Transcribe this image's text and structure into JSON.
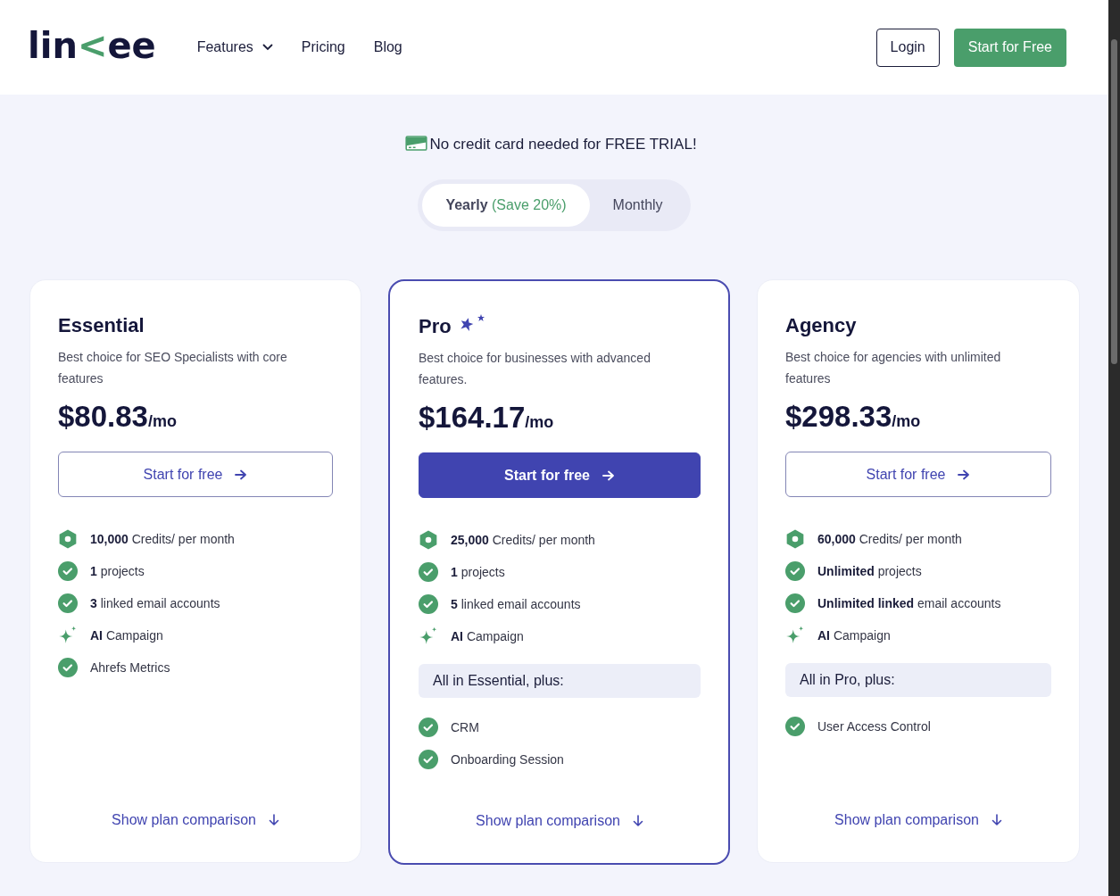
{
  "header": {
    "logo": {
      "lead": "lin",
      "mark": "<",
      "tail": "ee"
    },
    "nav": [
      {
        "label": "Features",
        "dropdown": true
      },
      {
        "label": "Pricing",
        "dropdown": false
      },
      {
        "label": "Blog",
        "dropdown": false
      }
    ],
    "login": "Login",
    "cta": "Start for Free"
  },
  "notice": "No credit card needed for FREE TRIAL!",
  "billing_toggle": [
    {
      "label": "Yearly",
      "note": "(Save 20%)",
      "selected": true
    },
    {
      "label": "Monthly",
      "selected": false
    }
  ],
  "plans": [
    {
      "name": "Essential",
      "featured": false,
      "description": "Best choice for SEO Specialists with core features",
      "price": "$80.83",
      "unit": "/mo",
      "button": "Start for free",
      "features": [
        {
          "kind": "credits",
          "text": "**10,000** Credits/ per month"
        },
        {
          "kind": "check",
          "text": "**1** projects"
        },
        {
          "kind": "check",
          "text": "**3** linked email accounts"
        },
        {
          "kind": "ai",
          "text": "**AI** Campaign"
        },
        {
          "kind": "check",
          "text": "Ahrefs Metrics"
        }
      ],
      "link": "Show plan comparison"
    },
    {
      "name": "Pro",
      "featured": true,
      "description": "Best choice for businesses with advanced features.",
      "price": "$164.17",
      "unit": "/mo",
      "button": "Start for free",
      "features": [
        {
          "kind": "credits",
          "text": "**25,000** Credits/ per month"
        },
        {
          "kind": "check",
          "text": "**1** projects"
        },
        {
          "kind": "check",
          "text": "**5** linked email accounts"
        },
        {
          "kind": "ai",
          "text": "**AI** Campaign"
        }
      ],
      "extras_heading": "All in Essential, plus:",
      "extras": [
        {
          "kind": "check",
          "text": "CRM"
        },
        {
          "kind": "check",
          "text": "Onboarding Session"
        }
      ],
      "link": "Show plan comparison"
    },
    {
      "name": "Agency",
      "featured": false,
      "description": "Best choice for agencies with unlimited features",
      "price": "$298.33",
      "unit": "/mo",
      "button": "Start for free",
      "features": [
        {
          "kind": "credits",
          "text": "**60,000** Credits/ per month"
        },
        {
          "kind": "check",
          "text": "**Unlimited** projects"
        },
        {
          "kind": "check",
          "text": "**Unlimited linked** email accounts"
        },
        {
          "kind": "ai",
          "text": "**AI** Campaign"
        }
      ],
      "extras_heading": "All in Pro, plus:",
      "extras": [
        {
          "kind": "check",
          "text": "User Access Control"
        }
      ],
      "link": "Show plan comparison"
    }
  ]
}
